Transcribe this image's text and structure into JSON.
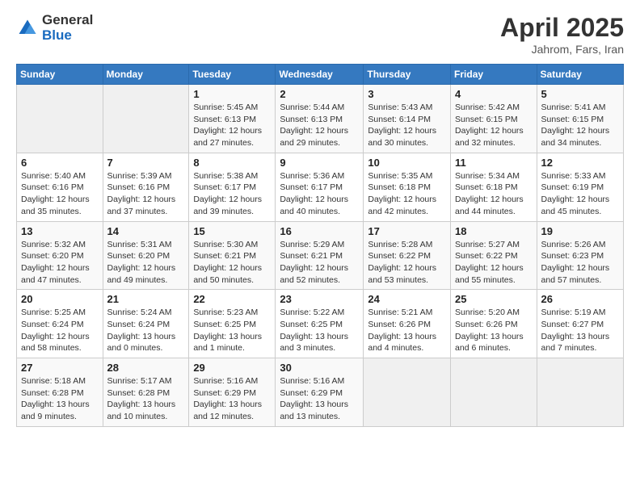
{
  "logo": {
    "general": "General",
    "blue": "Blue"
  },
  "title": {
    "month_year": "April 2025",
    "location": "Jahrom, Fars, Iran"
  },
  "weekdays": [
    "Sunday",
    "Monday",
    "Tuesday",
    "Wednesday",
    "Thursday",
    "Friday",
    "Saturday"
  ],
  "weeks": [
    [
      {
        "day": "",
        "info": ""
      },
      {
        "day": "",
        "info": ""
      },
      {
        "day": "1",
        "info": "Sunrise: 5:45 AM\nSunset: 6:13 PM\nDaylight: 12 hours and 27 minutes."
      },
      {
        "day": "2",
        "info": "Sunrise: 5:44 AM\nSunset: 6:13 PM\nDaylight: 12 hours and 29 minutes."
      },
      {
        "day": "3",
        "info": "Sunrise: 5:43 AM\nSunset: 6:14 PM\nDaylight: 12 hours and 30 minutes."
      },
      {
        "day": "4",
        "info": "Sunrise: 5:42 AM\nSunset: 6:15 PM\nDaylight: 12 hours and 32 minutes."
      },
      {
        "day": "5",
        "info": "Sunrise: 5:41 AM\nSunset: 6:15 PM\nDaylight: 12 hours and 34 minutes."
      }
    ],
    [
      {
        "day": "6",
        "info": "Sunrise: 5:40 AM\nSunset: 6:16 PM\nDaylight: 12 hours and 35 minutes."
      },
      {
        "day": "7",
        "info": "Sunrise: 5:39 AM\nSunset: 6:16 PM\nDaylight: 12 hours and 37 minutes."
      },
      {
        "day": "8",
        "info": "Sunrise: 5:38 AM\nSunset: 6:17 PM\nDaylight: 12 hours and 39 minutes."
      },
      {
        "day": "9",
        "info": "Sunrise: 5:36 AM\nSunset: 6:17 PM\nDaylight: 12 hours and 40 minutes."
      },
      {
        "day": "10",
        "info": "Sunrise: 5:35 AM\nSunset: 6:18 PM\nDaylight: 12 hours and 42 minutes."
      },
      {
        "day": "11",
        "info": "Sunrise: 5:34 AM\nSunset: 6:18 PM\nDaylight: 12 hours and 44 minutes."
      },
      {
        "day": "12",
        "info": "Sunrise: 5:33 AM\nSunset: 6:19 PM\nDaylight: 12 hours and 45 minutes."
      }
    ],
    [
      {
        "day": "13",
        "info": "Sunrise: 5:32 AM\nSunset: 6:20 PM\nDaylight: 12 hours and 47 minutes."
      },
      {
        "day": "14",
        "info": "Sunrise: 5:31 AM\nSunset: 6:20 PM\nDaylight: 12 hours and 49 minutes."
      },
      {
        "day": "15",
        "info": "Sunrise: 5:30 AM\nSunset: 6:21 PM\nDaylight: 12 hours and 50 minutes."
      },
      {
        "day": "16",
        "info": "Sunrise: 5:29 AM\nSunset: 6:21 PM\nDaylight: 12 hours and 52 minutes."
      },
      {
        "day": "17",
        "info": "Sunrise: 5:28 AM\nSunset: 6:22 PM\nDaylight: 12 hours and 53 minutes."
      },
      {
        "day": "18",
        "info": "Sunrise: 5:27 AM\nSunset: 6:22 PM\nDaylight: 12 hours and 55 minutes."
      },
      {
        "day": "19",
        "info": "Sunrise: 5:26 AM\nSunset: 6:23 PM\nDaylight: 12 hours and 57 minutes."
      }
    ],
    [
      {
        "day": "20",
        "info": "Sunrise: 5:25 AM\nSunset: 6:24 PM\nDaylight: 12 hours and 58 minutes."
      },
      {
        "day": "21",
        "info": "Sunrise: 5:24 AM\nSunset: 6:24 PM\nDaylight: 13 hours and 0 minutes."
      },
      {
        "day": "22",
        "info": "Sunrise: 5:23 AM\nSunset: 6:25 PM\nDaylight: 13 hours and 1 minute."
      },
      {
        "day": "23",
        "info": "Sunrise: 5:22 AM\nSunset: 6:25 PM\nDaylight: 13 hours and 3 minutes."
      },
      {
        "day": "24",
        "info": "Sunrise: 5:21 AM\nSunset: 6:26 PM\nDaylight: 13 hours and 4 minutes."
      },
      {
        "day": "25",
        "info": "Sunrise: 5:20 AM\nSunset: 6:26 PM\nDaylight: 13 hours and 6 minutes."
      },
      {
        "day": "26",
        "info": "Sunrise: 5:19 AM\nSunset: 6:27 PM\nDaylight: 13 hours and 7 minutes."
      }
    ],
    [
      {
        "day": "27",
        "info": "Sunrise: 5:18 AM\nSunset: 6:28 PM\nDaylight: 13 hours and 9 minutes."
      },
      {
        "day": "28",
        "info": "Sunrise: 5:17 AM\nSunset: 6:28 PM\nDaylight: 13 hours and 10 minutes."
      },
      {
        "day": "29",
        "info": "Sunrise: 5:16 AM\nSunset: 6:29 PM\nDaylight: 13 hours and 12 minutes."
      },
      {
        "day": "30",
        "info": "Sunrise: 5:16 AM\nSunset: 6:29 PM\nDaylight: 13 hours and 13 minutes."
      },
      {
        "day": "",
        "info": ""
      },
      {
        "day": "",
        "info": ""
      },
      {
        "day": "",
        "info": ""
      }
    ]
  ]
}
